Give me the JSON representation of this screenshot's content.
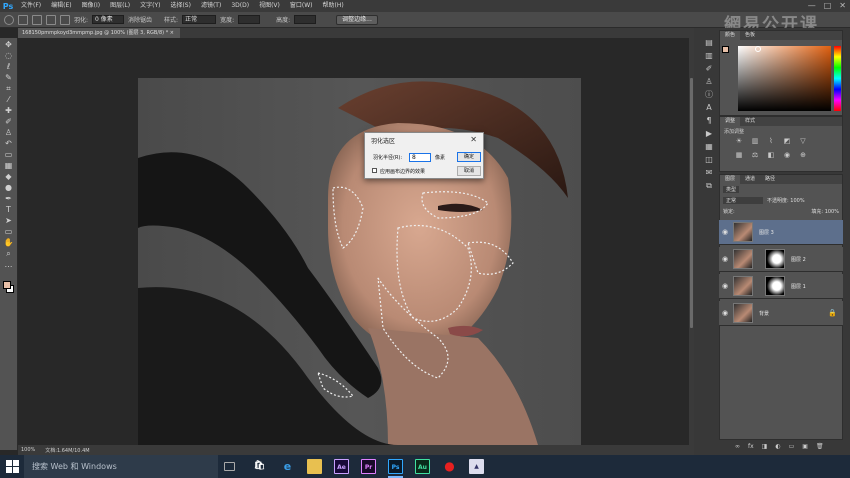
{
  "app": {
    "logo": "Ps"
  },
  "menu": [
    "文件(F)",
    "编辑(E)",
    "图像(I)",
    "图层(L)",
    "文字(Y)",
    "选择(S)",
    "滤镜(T)",
    "3D(D)",
    "视图(V)",
    "窗口(W)",
    "帮助(H)"
  ],
  "window_controls": {
    "minimize": "—",
    "maximize": "□",
    "close": "✕"
  },
  "options_bar": {
    "feather_label": "羽化:",
    "feather_value": "0 像素",
    "antialias_label": "消除锯齿",
    "style_label": "样式:",
    "style_value": "正常",
    "width_label": "宽度:",
    "height_label": "高度:",
    "refine_button": "调整边缘..."
  },
  "document": {
    "tab_title": "168150pmmpkoyd3mmpmp.jpg @ 100% (图层 3, RGB/8) *",
    "tab_close": "×",
    "zoom": "100%",
    "doc_info": "文档:1.64M/10.4M"
  },
  "dialog": {
    "title": "羽化选区",
    "close": "✕",
    "radius_label": "羽化半径(R):",
    "radius_value": "8",
    "unit": "像素",
    "apply_canvas_label": "应用画布边界的效果",
    "ok_button": "确定",
    "cancel_button": "取消"
  },
  "panels": {
    "color_tabs": [
      "颜色",
      "色板"
    ],
    "adjust_tabs": [
      "调整",
      "样式"
    ],
    "adjust_title": "添加调整",
    "layers_tabs": [
      "图层",
      "通道",
      "路径"
    ],
    "kind_label": "类型",
    "blend_mode": "正常",
    "opacity": "不透明度: 100%",
    "lock_label": "锁定:",
    "fill": "填充: 100%"
  },
  "layers": [
    {
      "name": "图层 3",
      "selected": true,
      "has_mask": false
    },
    {
      "name": "图层 2",
      "selected": false,
      "has_mask": true
    },
    {
      "name": "图层 1",
      "selected": false,
      "has_mask": true
    },
    {
      "name": "背景",
      "selected": false,
      "has_mask": false
    }
  ],
  "taskbar": {
    "search_placeholder": "搜索 Web 和 Windows",
    "apps": [
      "Ae",
      "Pr",
      "Ps",
      "Au"
    ]
  },
  "watermark": "網易公开课",
  "colors": {
    "foreground": "#e8c0a8",
    "background": "#ffffff",
    "accent": "#31a8ff"
  }
}
